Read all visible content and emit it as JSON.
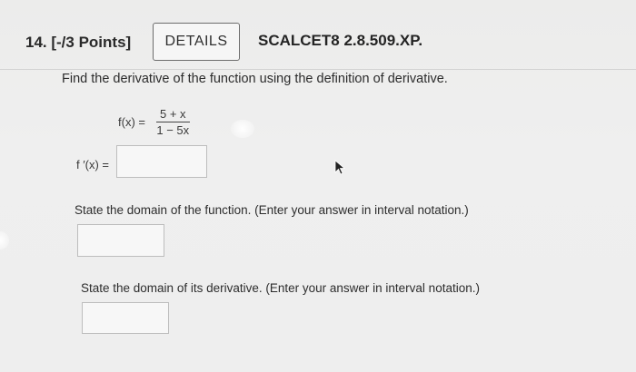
{
  "question": {
    "number_label": "14.  [-/3 Points]",
    "details_label": "DETAILS",
    "reference": "SCALCET8 2.8.509.XP."
  },
  "problem": {
    "prompt": "Find the derivative of the function using the definition of derivative.",
    "function_lhs": "f(x) =",
    "numerator": "5 + x",
    "denominator": "1 − 5x",
    "derivative_label": "f ′(x) ="
  },
  "answers": {
    "derivative_value": "",
    "domain_function_value": "",
    "domain_derivative_value": ""
  },
  "parts": {
    "domain_function_prompt": "State the domain of the function. (Enter your answer in interval notation.)",
    "domain_derivative_prompt": "State the domain of its derivative. (Enter your answer in interval notation.)"
  },
  "icons": {
    "cursor": "mouse-pointer-icon"
  }
}
